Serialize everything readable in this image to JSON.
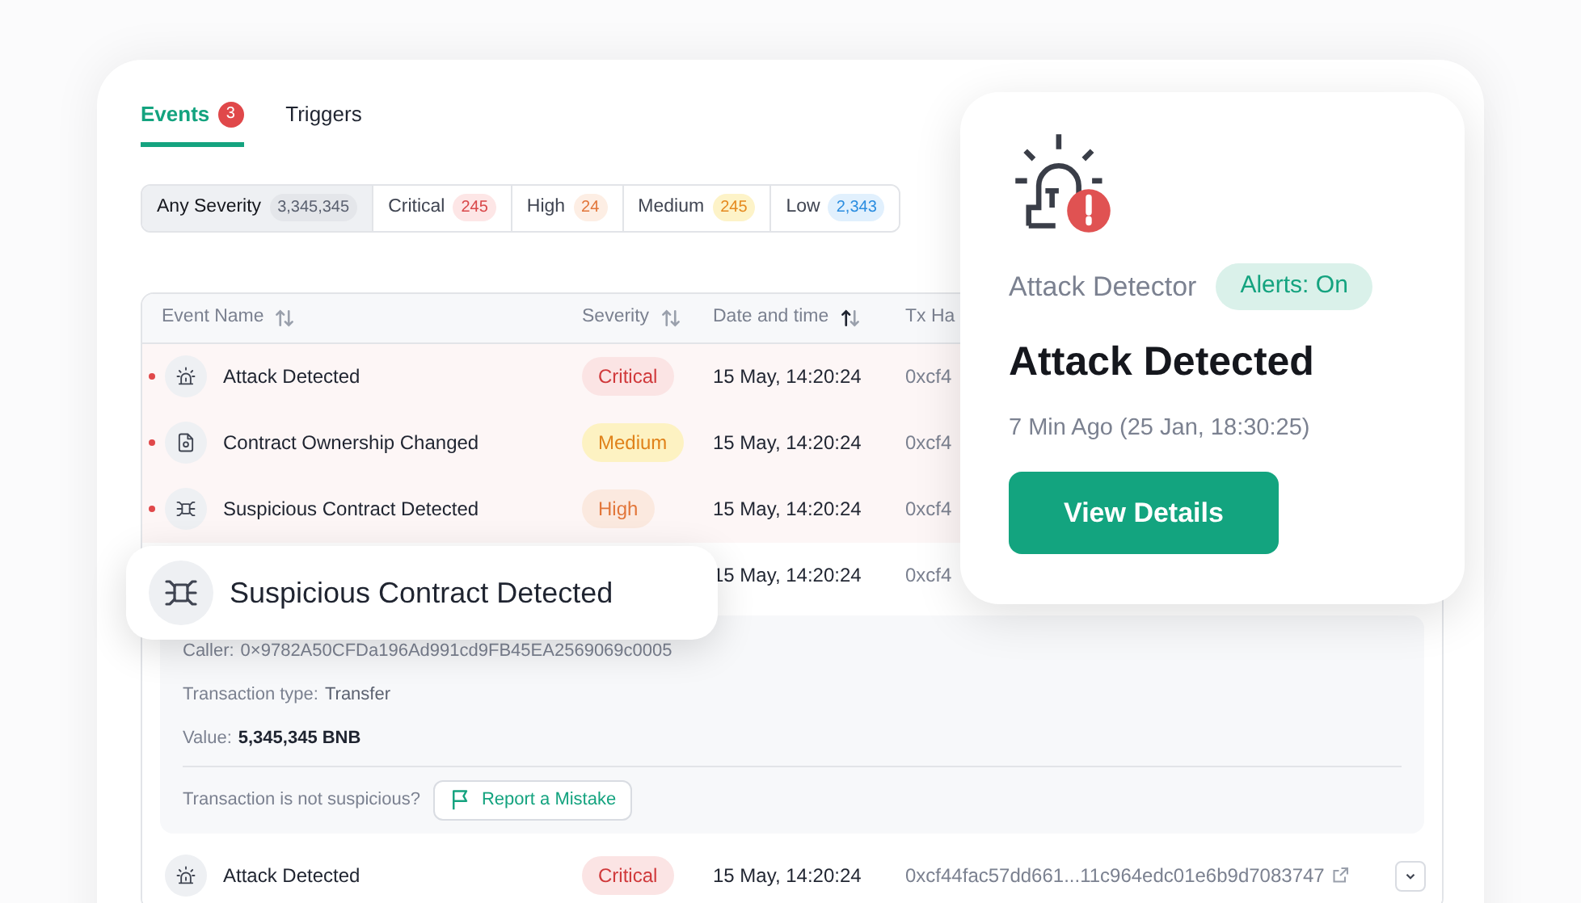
{
  "tabs": [
    {
      "label": "Events",
      "badge": "3",
      "selected": true
    },
    {
      "label": "Triggers",
      "selected": false
    }
  ],
  "severity_filters": [
    {
      "label": "Any Severity",
      "count": "3,345,345",
      "kind": "any",
      "selected": true
    },
    {
      "label": "Critical",
      "count": "245",
      "kind": "critical",
      "selected": false
    },
    {
      "label": "High",
      "count": "24",
      "kind": "high",
      "selected": false
    },
    {
      "label": "Medium",
      "count": "245",
      "kind": "medium",
      "selected": false
    },
    {
      "label": "Low",
      "count": "2,343",
      "kind": "low",
      "selected": false
    }
  ],
  "table": {
    "columns": [
      {
        "label": "Event Name",
        "sorted": false
      },
      {
        "label": "Severity",
        "sorted": false
      },
      {
        "label": "Date and time",
        "sorted": true
      },
      {
        "label": "Tx Ha"
      }
    ],
    "rows": [
      {
        "kind": "siren",
        "name": "Attack Detected",
        "severity": {
          "label": "Critical",
          "kind": "critical"
        },
        "date": "15 May, 14:20:24",
        "tx": "0xcf4",
        "unread": true
      },
      {
        "kind": "document",
        "name": "Contract Ownership Changed",
        "severity": {
          "label": "Medium",
          "kind": "medium"
        },
        "date": "15 May, 14:20:24",
        "tx": "0xcf4",
        "unread": true
      },
      {
        "kind": "network",
        "name": "Suspicious Contract Detected",
        "severity": {
          "label": "High",
          "kind": "high"
        },
        "date": "15 May, 14:20:24",
        "tx": "0xcf4",
        "unread": true
      },
      {
        "date": "15 May, 14:20:24",
        "tx": "0xcf4",
        "unread": false,
        "expanded": true,
        "details": {
          "caller_label": "Caller:",
          "caller": "0×9782A50CFDa196Ad991cd9FB45EA2569069c0005",
          "type_label": "Transaction type:",
          "type": "Transfer",
          "value_label": "Value:",
          "value": "5,345,345 BNB",
          "question": "Transaction is not suspicious?",
          "report_button": "Report a Mistake"
        }
      },
      {
        "kind": "siren",
        "name": "Attack Detected",
        "severity": {
          "label": "Critical",
          "kind": "critical"
        },
        "date": "15 May, 14:20:24",
        "tx": "0xcf44fac57dd661...11c964edc01e6b9d7083747",
        "unread": false,
        "link": true,
        "expanded": false
      }
    ]
  },
  "floating_event": {
    "kind": "network",
    "name": "Suspicious Contract Detected"
  },
  "alert_card": {
    "detector": "Attack Detector",
    "alerts_badge": "Alerts: On",
    "alerts_on": true,
    "title": "Attack Detected",
    "time": "7 Min Ago (25 Jan, 18:30:25)",
    "button": "View Details"
  }
}
